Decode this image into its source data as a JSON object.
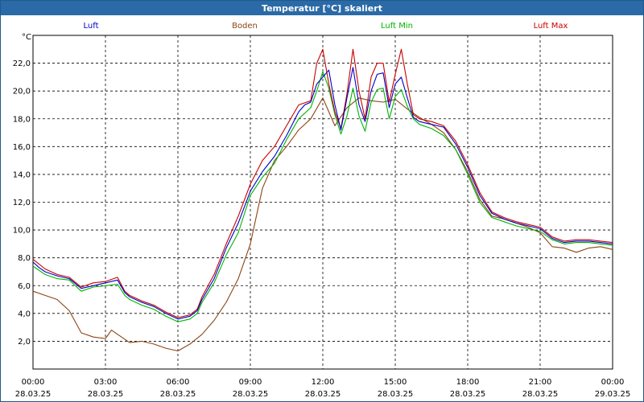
{
  "window": {
    "title": "Temperatur [°C] skaliert"
  },
  "chart_data": {
    "type": "line",
    "title": "Temperatur [°C] skaliert",
    "ylabel": "°C",
    "xlabel": "",
    "ylim": [
      0,
      24
    ],
    "yticks": [
      "2,0",
      "4,0",
      "6,0",
      "8,0",
      "10,0",
      "12,0",
      "14,0",
      "16,0",
      "18,0",
      "20,0",
      "22,0"
    ],
    "yticks_values": [
      2,
      4,
      6,
      8,
      10,
      12,
      14,
      16,
      18,
      20,
      22
    ],
    "xlim": [
      0,
      24
    ],
    "xticks": [
      {
        "time": "00:00",
        "date": "28.03.25"
      },
      {
        "time": "03:00",
        "date": "28.03.25"
      },
      {
        "time": "06:00",
        "date": "28.03.25"
      },
      {
        "time": "09:00",
        "date": "28.03.25"
      },
      {
        "time": "12:00",
        "date": "28.03.25"
      },
      {
        "time": "15:00",
        "date": "28.03.25"
      },
      {
        "time": "18:00",
        "date": "28.03.25"
      },
      {
        "time": "21:00",
        "date": "28.03.25"
      },
      {
        "time": "00:00",
        "date": "29.03.25"
      }
    ],
    "xticks_values": [
      0,
      3,
      6,
      9,
      12,
      15,
      18,
      21,
      24
    ],
    "grid": true,
    "legend_position": "top",
    "series": [
      {
        "name": "Luft",
        "color": "#0000c8",
        "x": [
          0,
          0.25,
          0.5,
          1,
          1.5,
          2,
          2.5,
          3,
          3.5,
          3.8,
          4,
          4.5,
          5,
          5.5,
          6,
          6.5,
          6.8,
          7,
          7.5,
          8,
          8.5,
          9,
          9.5,
          10,
          10.5,
          11,
          11.25,
          11.5,
          11.75,
          12,
          12.25,
          12.5,
          12.75,
          13,
          13.25,
          13.5,
          13.75,
          14,
          14.25,
          14.5,
          14.75,
          15,
          15.25,
          15.5,
          15.75,
          16,
          16.5,
          17,
          17.5,
          18,
          18.5,
          19,
          19.5,
          20,
          20.5,
          21,
          21.5,
          22,
          22.5,
          23,
          23.5,
          24
        ],
        "y": [
          7.7,
          7.3,
          7.0,
          6.7,
          6.5,
          5.8,
          6.0,
          6.2,
          6.4,
          5.5,
          5.2,
          4.8,
          4.5,
          4.0,
          3.6,
          3.8,
          4.2,
          5.0,
          6.5,
          8.7,
          10.5,
          12.8,
          14.2,
          15.3,
          16.8,
          18.5,
          19.0,
          19.2,
          20.5,
          21.0,
          21.5,
          19.0,
          17.2,
          19.5,
          21.7,
          19.0,
          17.8,
          20.0,
          21.2,
          21.3,
          18.8,
          20.5,
          21.0,
          19.5,
          18.1,
          17.8,
          17.6,
          17.4,
          16.2,
          14.5,
          12.5,
          11.2,
          10.8,
          10.5,
          10.3,
          10.1,
          9.4,
          9.1,
          9.2,
          9.2,
          9.1,
          9.0
        ]
      },
      {
        "name": "Boden",
        "color": "#8b4513",
        "x": [
          0,
          0.5,
          1,
          1.5,
          2,
          2.5,
          3,
          3.25,
          3.5,
          4,
          4.5,
          5,
          5.5,
          6,
          6.5,
          7,
          7.5,
          8,
          8.5,
          9,
          9.5,
          10,
          10.5,
          11,
          11.5,
          12,
          12.5,
          13,
          13.5,
          14,
          14.5,
          15,
          15.5,
          16,
          16.5,
          17,
          17.5,
          18,
          18.5,
          19,
          19.5,
          20,
          20.5,
          21,
          21.5,
          22,
          22.5,
          23,
          23.5,
          24
        ],
        "y": [
          5.6,
          5.3,
          5.0,
          4.2,
          2.6,
          2.3,
          2.2,
          2.8,
          2.5,
          1.9,
          2.0,
          1.8,
          1.5,
          1.3,
          1.8,
          2.5,
          3.5,
          4.8,
          6.5,
          9.0,
          13.0,
          15.0,
          16.0,
          17.2,
          18.0,
          19.5,
          17.5,
          18.8,
          19.5,
          19.3,
          19.2,
          19.4,
          18.7,
          18.1,
          17.6,
          17.0,
          15.8,
          14.2,
          12.2,
          11.0,
          10.8,
          10.5,
          10.2,
          9.8,
          8.8,
          8.7,
          8.4,
          8.7,
          8.8,
          8.6
        ]
      },
      {
        "name": "Luft Min",
        "color": "#00b400",
        "x": [
          0,
          0.5,
          1,
          1.5,
          2,
          2.5,
          3,
          3.5,
          3.8,
          4,
          4.5,
          5,
          5.5,
          6,
          6.5,
          6.8,
          7,
          7.5,
          8,
          8.5,
          9,
          9.5,
          10,
          10.5,
          11,
          11.5,
          11.75,
          12,
          12.25,
          12.5,
          12.75,
          13,
          13.25,
          13.5,
          13.75,
          14,
          14.25,
          14.5,
          14.75,
          15,
          15.25,
          15.5,
          15.75,
          16,
          16.5,
          17,
          17.5,
          18,
          18.5,
          19,
          19.5,
          20,
          20.5,
          21,
          21.5,
          22,
          22.5,
          23,
          23.5,
          24
        ],
        "y": [
          7.4,
          6.8,
          6.5,
          6.4,
          5.6,
          5.9,
          6.0,
          6.1,
          5.3,
          5.0,
          4.6,
          4.3,
          3.8,
          3.4,
          3.6,
          4.0,
          4.8,
          6.2,
          8.2,
          9.8,
          12.5,
          13.8,
          14.8,
          16.5,
          18.0,
          18.8,
          20.0,
          21.4,
          20.2,
          18.3,
          16.9,
          18.2,
          20.2,
          18.2,
          17.1,
          19.2,
          20.1,
          20.2,
          18.0,
          19.6,
          20.1,
          18.9,
          18.0,
          17.6,
          17.3,
          16.8,
          15.8,
          14.0,
          12.0,
          10.9,
          10.6,
          10.3,
          10.1,
          9.9,
          9.3,
          9.0,
          9.1,
          9.1,
          9.0,
          8.9
        ]
      },
      {
        "name": "Luft Max",
        "color": "#c80000",
        "x": [
          0,
          0.5,
          1,
          1.5,
          2,
          2.5,
          3,
          3.5,
          3.8,
          4,
          4.5,
          5,
          5.5,
          6,
          6.5,
          6.8,
          7,
          7.5,
          8,
          8.5,
          9,
          9.5,
          10,
          10.5,
          11,
          11.5,
          11.75,
          12,
          12.25,
          12.5,
          12.75,
          13,
          13.25,
          13.5,
          13.75,
          14,
          14.25,
          14.5,
          14.75,
          15,
          15.25,
          15.5,
          15.75,
          16,
          16.5,
          17,
          17.5,
          18,
          18.5,
          19,
          19.5,
          20,
          20.5,
          21,
          21.5,
          22,
          22.5,
          23,
          23.5,
          24
        ],
        "y": [
          7.9,
          7.2,
          6.8,
          6.6,
          5.9,
          6.2,
          6.3,
          6.6,
          5.6,
          5.3,
          4.9,
          4.6,
          4.1,
          3.7,
          3.9,
          4.3,
          5.2,
          6.8,
          9.0,
          11.0,
          13.3,
          15.0,
          16.0,
          17.5,
          19.0,
          19.3,
          22.0,
          23.0,
          20.5,
          18.5,
          17.3,
          19.8,
          23.0,
          20.0,
          18.0,
          21.0,
          22.0,
          22.0,
          19.2,
          21.2,
          23.0,
          20.5,
          18.3,
          18.0,
          17.8,
          17.5,
          16.4,
          14.7,
          12.7,
          11.3,
          10.9,
          10.6,
          10.4,
          10.2,
          9.5,
          9.2,
          9.3,
          9.3,
          9.2,
          9.1
        ]
      }
    ]
  }
}
